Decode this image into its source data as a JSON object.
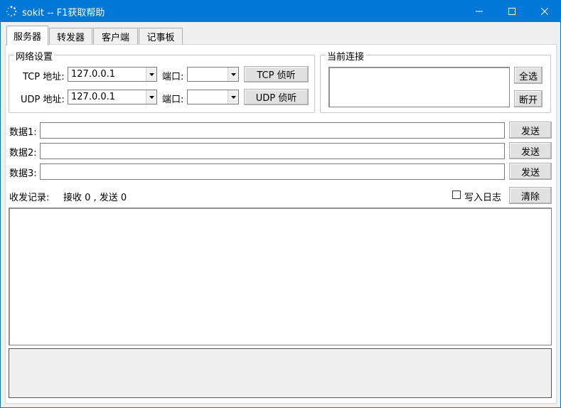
{
  "window": {
    "title": "sokit -- F1获取帮助"
  },
  "tabs": [
    {
      "label": "服务器",
      "active": true
    },
    {
      "label": "转发器",
      "active": false
    },
    {
      "label": "客户端",
      "active": false
    },
    {
      "label": "记事板",
      "active": false
    }
  ],
  "network": {
    "legend": "网络设置",
    "tcp_label": "TCP 地址:",
    "tcp_addr": "127.0.0.1",
    "udp_label": "UDP 地址:",
    "udp_addr": "127.0.0.1",
    "port_label": "端口:",
    "tcp_port": "",
    "udp_port": "",
    "tcp_listen": "TCP 侦听",
    "udp_listen": "UDP 侦听"
  },
  "connection": {
    "legend": "当前连接",
    "select_all": "全选",
    "disconnect": "断开"
  },
  "data": [
    {
      "label": "数据1:",
      "value": "",
      "send": "发送"
    },
    {
      "label": "数据2:",
      "value": "",
      "send": "发送"
    },
    {
      "label": "数据3:",
      "value": "",
      "send": "发送"
    }
  ],
  "log": {
    "label": "收发记录:",
    "stats": "接收 0 , 发送 0",
    "write_log": "写入日志",
    "write_log_checked": false,
    "clear": "清除"
  },
  "colors": {
    "titlebar": "#0078d7",
    "face": "#f0f0f0",
    "panel": "#ffffff"
  }
}
